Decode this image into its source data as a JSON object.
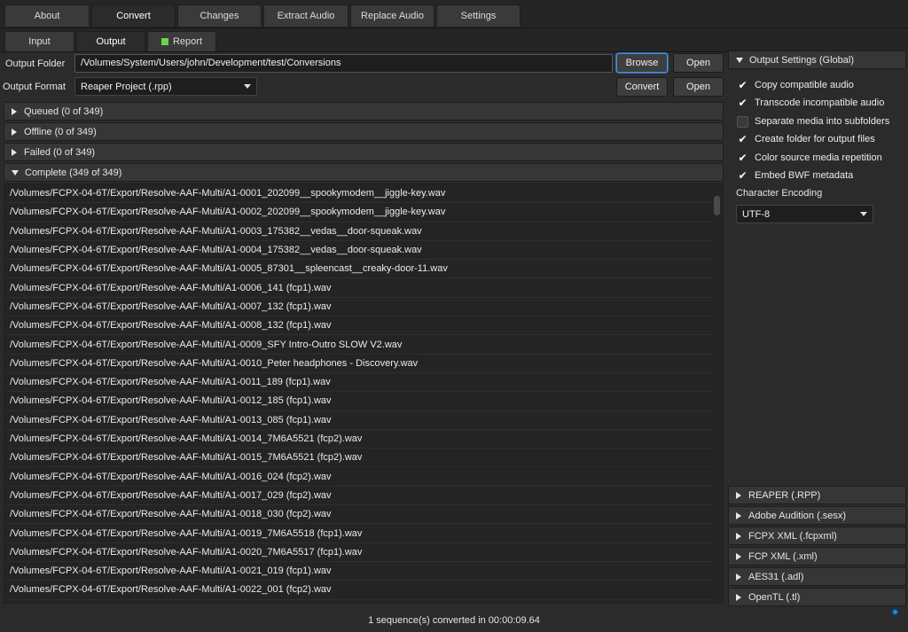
{
  "tabs": [
    {
      "label": "About"
    },
    {
      "label": "Convert"
    },
    {
      "label": "Changes"
    },
    {
      "label": "Extract Audio"
    },
    {
      "label": "Replace Audio"
    },
    {
      "label": "Settings"
    }
  ],
  "subtabs": [
    {
      "label": "Input"
    },
    {
      "label": "Output"
    },
    {
      "label": "Report"
    }
  ],
  "output_folder": {
    "label": "Output Folder",
    "value": "/Volumes/System/Users/john/Development/test/Conversions",
    "browse_label": "Browse",
    "open_label": "Open"
  },
  "output_format": {
    "label": "Output Format",
    "value": "Reaper Project (.rpp)",
    "convert_label": "Convert",
    "open_label": "Open"
  },
  "groups": [
    {
      "label": "Queued (0 of 349)"
    },
    {
      "label": "Offline (0 of 349)"
    },
    {
      "label": "Failed (0 of 349)"
    },
    {
      "label": "Complete (349 of 349)"
    }
  ],
  "files": [
    "/Volumes/FCPX-04-6T/Export/Resolve-AAF-Multi/A1-0001_202099__spookymodem__jiggle-key.wav",
    "/Volumes/FCPX-04-6T/Export/Resolve-AAF-Multi/A1-0002_202099__spookymodem__jiggle-key.wav",
    "/Volumes/FCPX-04-6T/Export/Resolve-AAF-Multi/A1-0003_175382__vedas__door-squeak.wav",
    "/Volumes/FCPX-04-6T/Export/Resolve-AAF-Multi/A1-0004_175382__vedas__door-squeak.wav",
    "/Volumes/FCPX-04-6T/Export/Resolve-AAF-Multi/A1-0005_87301__spleencast__creaky-door-11.wav",
    "/Volumes/FCPX-04-6T/Export/Resolve-AAF-Multi/A1-0006_141 (fcp1).wav",
    "/Volumes/FCPX-04-6T/Export/Resolve-AAF-Multi/A1-0007_132 (fcp1).wav",
    "/Volumes/FCPX-04-6T/Export/Resolve-AAF-Multi/A1-0008_132 (fcp1).wav",
    "/Volumes/FCPX-04-6T/Export/Resolve-AAF-Multi/A1-0009_SFY Intro-Outro SLOW V2.wav",
    "/Volumes/FCPX-04-6T/Export/Resolve-AAF-Multi/A1-0010_Peter headphones - Discovery.wav",
    "/Volumes/FCPX-04-6T/Export/Resolve-AAF-Multi/A1-0011_189 (fcp1).wav",
    "/Volumes/FCPX-04-6T/Export/Resolve-AAF-Multi/A1-0012_185 (fcp1).wav",
    "/Volumes/FCPX-04-6T/Export/Resolve-AAF-Multi/A1-0013_085 (fcp1).wav",
    "/Volumes/FCPX-04-6T/Export/Resolve-AAF-Multi/A1-0014_7M6A5521 (fcp2).wav",
    "/Volumes/FCPX-04-6T/Export/Resolve-AAF-Multi/A1-0015_7M6A5521 (fcp2).wav",
    "/Volumes/FCPX-04-6T/Export/Resolve-AAF-Multi/A1-0016_024 (fcp2).wav",
    "/Volumes/FCPX-04-6T/Export/Resolve-AAF-Multi/A1-0017_029 (fcp2).wav",
    "/Volumes/FCPX-04-6T/Export/Resolve-AAF-Multi/A1-0018_030 (fcp2).wav",
    "/Volumes/FCPX-04-6T/Export/Resolve-AAF-Multi/A1-0019_7M6A5518 (fcp1).wav",
    "/Volumes/FCPX-04-6T/Export/Resolve-AAF-Multi/A1-0020_7M6A5517 (fcp1).wav",
    "/Volumes/FCPX-04-6T/Export/Resolve-AAF-Multi/A1-0021_019 (fcp1).wav",
    "/Volumes/FCPX-04-6T/Export/Resolve-AAF-Multi/A1-0022_001 (fcp2).wav"
  ],
  "settings": {
    "header": "Output Settings (Global)",
    "options": [
      {
        "label": "Copy compatible audio",
        "checked": true
      },
      {
        "label": "Transcode incompatible audio",
        "checked": true
      },
      {
        "label": "Separate media into subfolders",
        "checked": false
      },
      {
        "label": "Create folder for output files",
        "checked": true
      },
      {
        "label": "Color source media repetition",
        "checked": true
      },
      {
        "label": "Embed BWF metadata",
        "checked": true
      }
    ],
    "encoding_label": "Character Encoding",
    "encoding_value": "UTF-8"
  },
  "format_sections": [
    {
      "label": "REAPER (.RPP)"
    },
    {
      "label": "Adobe Audition (.sesx)"
    },
    {
      "label": "FCPX XML (.fcpxml)"
    },
    {
      "label": "FCP XML (.xml)"
    },
    {
      "label": "AES31 (.adl)"
    },
    {
      "label": "OpenTL (.tl)"
    }
  ],
  "status": "1 sequence(s) converted in 00:00:09.64"
}
